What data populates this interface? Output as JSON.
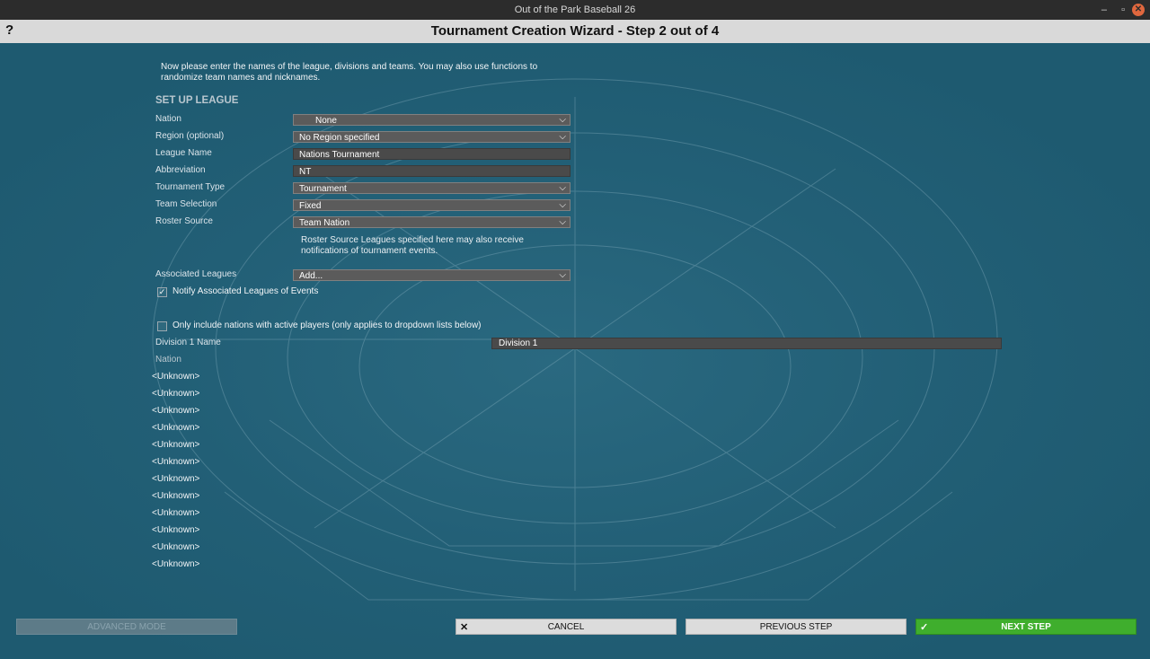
{
  "window": {
    "title": "Out of the Park Baseball 26",
    "minimize": "–",
    "maximize": "▫",
    "close": "✕"
  },
  "header": {
    "help": "?",
    "title": "Tournament Creation Wizard - Step 2 out of 4"
  },
  "intro": "Now please enter the names of the league, divisions and teams. You may also use functions to randomize team names and nicknames.",
  "setup": {
    "section_title": "SET UP LEAGUE",
    "nation": {
      "label": "Nation",
      "value": "None"
    },
    "region": {
      "label": "Region (optional)",
      "value": "No Region specified"
    },
    "league_name": {
      "label": "League Name",
      "value": "Nations Tournament"
    },
    "abbreviation": {
      "label": "Abbreviation",
      "value": "NT"
    },
    "tournament_type": {
      "label": "Tournament Type",
      "value": "Tournament"
    },
    "team_selection": {
      "label": "Team Selection",
      "value": "Fixed"
    },
    "roster_source": {
      "label": "Roster Source",
      "value": "Team Nation"
    },
    "roster_note": "Roster Source Leagues specified here may also receive notifications of tournament events.",
    "associated_leagues": {
      "label": "Associated Leagues",
      "value": "Add..."
    },
    "notify_checkbox": {
      "label": "Notify Associated Leagues of Events",
      "checked": true
    }
  },
  "nations_filter": {
    "label": "Only include nations with active players (only applies to dropdown lists below)",
    "checked": false
  },
  "division": {
    "label": "Division 1 Name",
    "value": "Division 1",
    "nation_header": "Nation"
  },
  "teams": [
    "<Unknown>",
    "<Unknown>",
    "<Unknown>",
    "<Unknown>",
    "<Unknown>",
    "<Unknown>",
    "<Unknown>",
    "<Unknown>",
    "<Unknown>",
    "<Unknown>",
    "<Unknown>",
    "<Unknown>"
  ],
  "buttons": {
    "advanced": "ADVANCED MODE",
    "cancel": "CANCEL",
    "cancel_icon": "✕",
    "previous": "PREVIOUS STEP",
    "next": "NEXT STEP",
    "next_icon": "✓"
  },
  "colors": {
    "background": "#1e5a70",
    "next_button": "#3fae2d",
    "header": "#d9d9d9"
  }
}
